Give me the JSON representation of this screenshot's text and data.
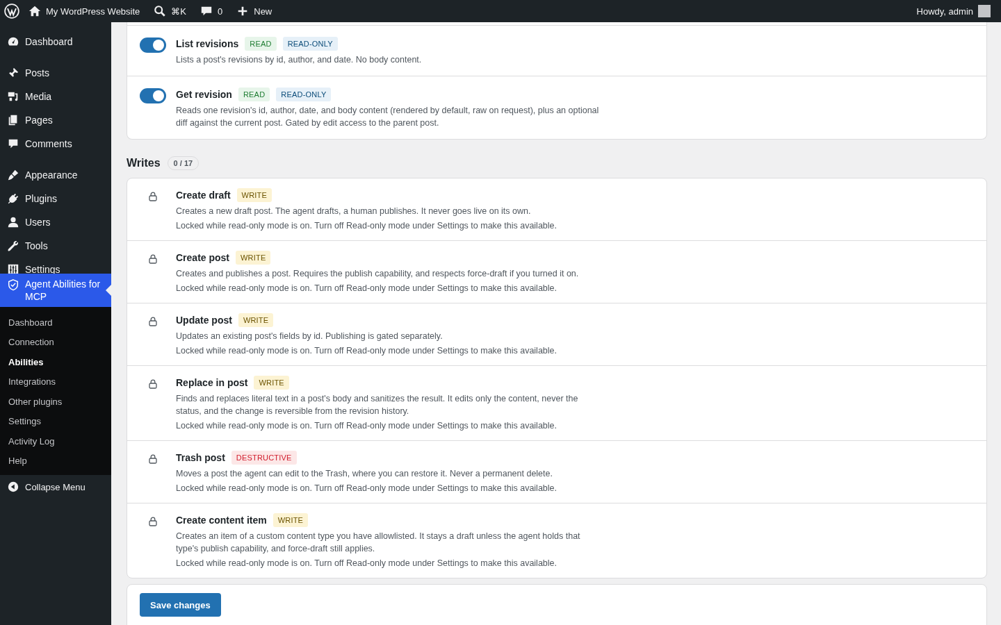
{
  "admin_bar": {
    "site_name": "My WordPress Website",
    "search_shortcut": "⌘K",
    "comments_count": "0",
    "new_label": "New",
    "greeting": "Howdy, admin"
  },
  "sidebar": {
    "menu_groups": [
      [
        {
          "label": "Dashboard",
          "selected": false
        }
      ],
      [
        {
          "label": "Posts",
          "selected": false
        },
        {
          "label": "Media",
          "selected": false
        },
        {
          "label": "Pages",
          "selected": false
        },
        {
          "label": "Comments",
          "selected": false
        }
      ],
      [
        {
          "label": "Appearance",
          "selected": false
        },
        {
          "label": "Plugins",
          "selected": false
        },
        {
          "label": "Users",
          "selected": false
        },
        {
          "label": "Tools",
          "selected": false
        },
        {
          "label": "Settings",
          "selected": false
        },
        {
          "label": "Agent Abilities for MCP",
          "selected": true
        }
      ]
    ],
    "submenu": [
      {
        "label": "Dashboard",
        "selected": false
      },
      {
        "label": "Connection",
        "selected": false
      },
      {
        "label": "Abilities",
        "selected": true
      },
      {
        "label": "Integrations",
        "selected": false
      },
      {
        "label": "Other plugins",
        "selected": false
      },
      {
        "label": "Settings",
        "selected": false
      },
      {
        "label": "Activity Log",
        "selected": false
      },
      {
        "label": "Help",
        "selected": false
      }
    ],
    "collapse_label": "Collapse Menu"
  },
  "read_abilities": [
    {
      "title": "List revisions",
      "tags": [
        {
          "label": "READ",
          "kind": "read"
        },
        {
          "label": "READ-ONLY",
          "kind": "readonly"
        }
      ],
      "description": "Lists a post's revisions by id, author, and date. No body content.",
      "locked": false,
      "enabled": true
    },
    {
      "title": "Get revision",
      "tags": [
        {
          "label": "READ",
          "kind": "read"
        },
        {
          "label": "READ-ONLY",
          "kind": "readonly"
        }
      ],
      "description": "Reads one revision's id, author, date, and body content (rendered by default, raw on request), plus an optional diff against the current post. Gated by edit access to the parent post.",
      "locked": false,
      "enabled": true
    }
  ],
  "writes": {
    "title": "Writes",
    "count": "0 / 17",
    "abilities": [
      {
        "title": "Create draft",
        "tags": [
          {
            "label": "WRITE",
            "kind": "write"
          }
        ],
        "description": "Creates a new draft post. The agent drafts, a human publishes. It never goes live on its own.",
        "locked": true,
        "lock_note": "Locked while read-only mode is on. Turn off Read-only mode under Settings to make this available."
      },
      {
        "title": "Create post",
        "tags": [
          {
            "label": "WRITE",
            "kind": "write"
          }
        ],
        "description": "Creates and publishes a post. Requires the publish capability, and respects force-draft if you turned it on.",
        "locked": true,
        "lock_note": "Locked while read-only mode is on. Turn off Read-only mode under Settings to make this available."
      },
      {
        "title": "Update post",
        "tags": [
          {
            "label": "WRITE",
            "kind": "write"
          }
        ],
        "description": "Updates an existing post's fields by id. Publishing is gated separately.",
        "locked": true,
        "lock_note": "Locked while read-only mode is on. Turn off Read-only mode under Settings to make this available."
      },
      {
        "title": "Replace in post",
        "tags": [
          {
            "label": "WRITE",
            "kind": "write"
          }
        ],
        "description": "Finds and replaces literal text in a post's body and sanitizes the result. It edits only the content, never the status, and the change is reversible from the revision history.",
        "locked": true,
        "lock_note": "Locked while read-only mode is on. Turn off Read-only mode under Settings to make this available."
      },
      {
        "title": "Trash post",
        "tags": [
          {
            "label": "DESTRUCTIVE",
            "kind": "destructive"
          }
        ],
        "description": "Moves a post the agent can edit to the Trash, where you can restore it. Never a permanent delete.",
        "locked": true,
        "lock_note": "Locked while read-only mode is on. Turn off Read-only mode under Settings to make this available."
      },
      {
        "title": "Create content item",
        "tags": [
          {
            "label": "WRITE",
            "kind": "write"
          }
        ],
        "description": "Creates an item of a custom content type you have allowlisted. It stays a draft unless the agent holds that type's publish capability, and force-draft still applies.",
        "locked": true,
        "lock_note": "Locked while read-only mode is on. Turn off Read-only mode under Settings to make this available."
      }
    ]
  },
  "save_button": "Save changes"
}
